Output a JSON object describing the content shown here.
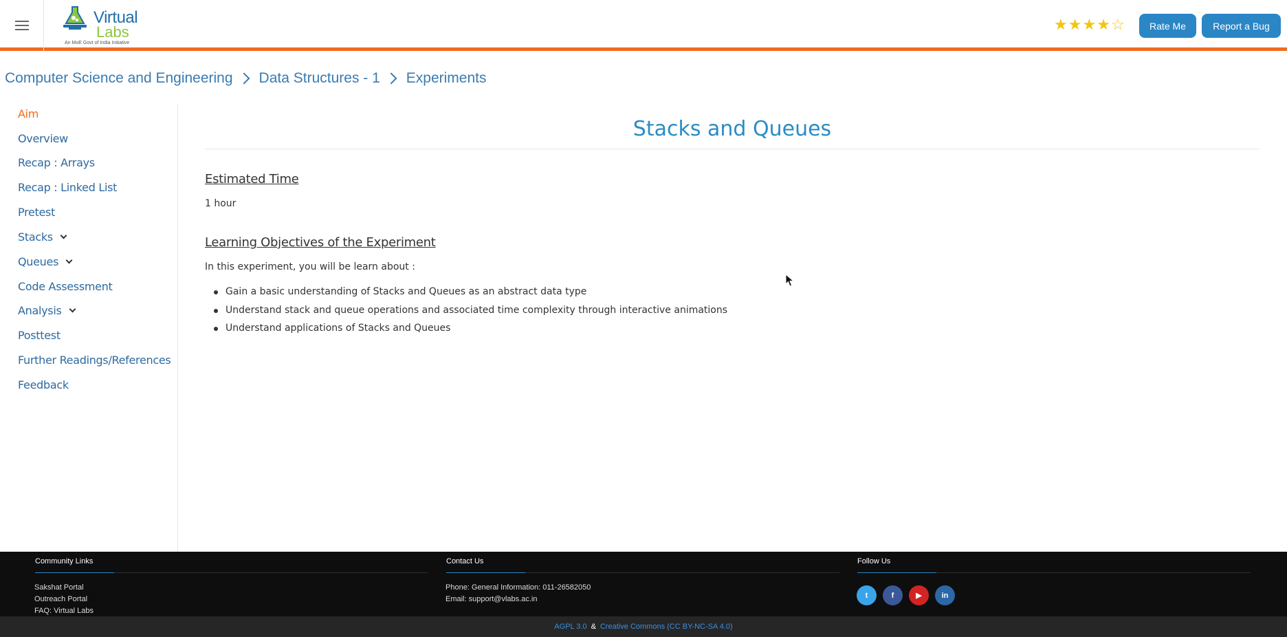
{
  "header": {
    "menu_icon": "hamburger-menu-icon",
    "logo": {
      "word1": "Virtual",
      "word2": "Labs",
      "tagline": "An MoE Govt of India Initiative"
    },
    "rating": {
      "filled": 4,
      "max": 5,
      "color": "#f2c511"
    },
    "rate_label": "Rate Me",
    "bug_label": "Report a Bug",
    "accent_color": "#f26a1b"
  },
  "breadcrumb": {
    "items": [
      "Computer Science and Engineering",
      "Data Structures - 1",
      "Experiments"
    ]
  },
  "sidebar": {
    "items": [
      {
        "label": "Aim",
        "active": true,
        "has_submenu": false
      },
      {
        "label": "Overview",
        "active": false,
        "has_submenu": false
      },
      {
        "label": "Recap : Arrays",
        "active": false,
        "has_submenu": false
      },
      {
        "label": "Recap : Linked List",
        "active": false,
        "has_submenu": false
      },
      {
        "label": "Pretest",
        "active": false,
        "has_submenu": false
      },
      {
        "label": "Stacks",
        "active": false,
        "has_submenu": true
      },
      {
        "label": "Queues",
        "active": false,
        "has_submenu": true
      },
      {
        "label": "Code Assessment",
        "active": false,
        "has_submenu": false
      },
      {
        "label": "Analysis",
        "active": false,
        "has_submenu": true
      },
      {
        "label": "Posttest",
        "active": false,
        "has_submenu": false
      },
      {
        "label": "Further Readings/References",
        "active": false,
        "has_submenu": false
      },
      {
        "label": "Feedback",
        "active": false,
        "has_submenu": false
      }
    ]
  },
  "main": {
    "title": "Stacks and Queues",
    "estimated_time_heading": "Estimated Time",
    "estimated_time": "1 hour",
    "objectives_heading": "Learning Objectives of the Experiment",
    "objectives_intro": "In this experiment, you will be learn about :",
    "objectives": [
      "Gain a basic understanding of Stacks and Queues as an abstract data type",
      "Understand stack and queue operations and associated time complexity through interactive animations",
      "Understand applications of Stacks and Queues"
    ]
  },
  "footer": {
    "community": {
      "heading": "Community Links",
      "links": [
        "Sakshat Portal",
        "Outreach Portal",
        "FAQ: Virtual Labs"
      ]
    },
    "contact": {
      "heading": "Contact Us",
      "phone": "Phone: General Information: 011-26582050",
      "email": "Email: support@vlabs.ac.in"
    },
    "follow": {
      "heading": "Follow Us",
      "icons": [
        {
          "name": "twitter-icon",
          "glyph": "t",
          "color": "#3aa4e9"
        },
        {
          "name": "facebook-icon",
          "glyph": "f",
          "color": "#3b5998"
        },
        {
          "name": "youtube-icon",
          "glyph": "▶",
          "color": "#d32424"
        },
        {
          "name": "linkedin-icon",
          "glyph": "in",
          "color": "#2c68a8"
        }
      ]
    },
    "license_1": "AGPL 3.0",
    "license_sep": "&",
    "license_2": "Creative Commons (CC BY-NC-SA 4.0)"
  }
}
